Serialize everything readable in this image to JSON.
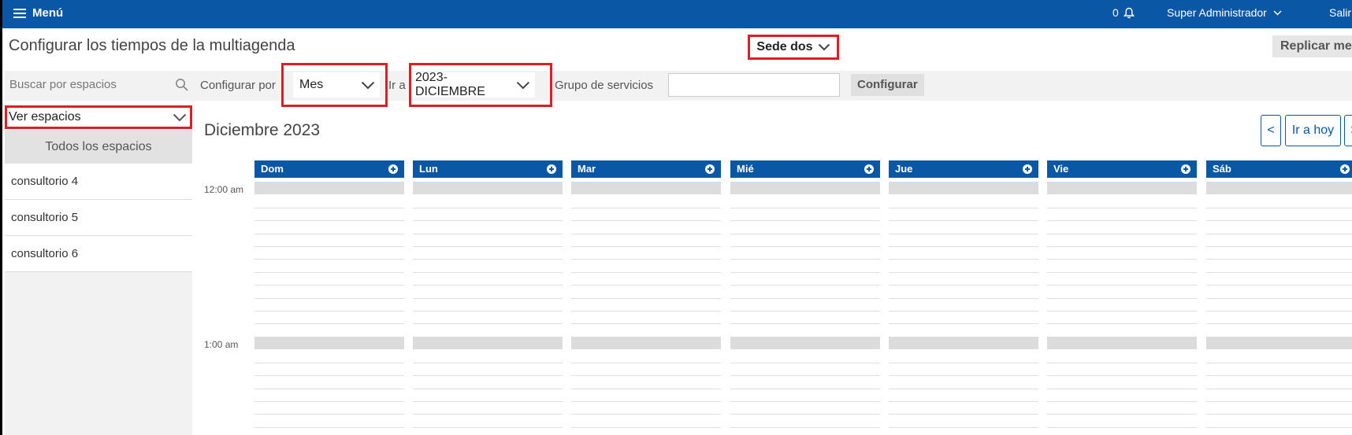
{
  "topbar": {
    "menu_label": "Menú",
    "notif_count": "0",
    "user_label": "Super Administrador",
    "logout_label": "Salir"
  },
  "page": {
    "title": "Configurar los tiempos de la multiagenda",
    "sede_label": "Sede dos",
    "replicar_label": "Replicar mes"
  },
  "sidebar": {
    "search_placeholder": "Buscar por espacios",
    "ver_espacios": "Ver espacios",
    "todos_label": "Todos los espacios",
    "items": [
      {
        "label": "consultorio 4"
      },
      {
        "label": "consultorio 5"
      },
      {
        "label": "consultorio 6"
      }
    ]
  },
  "filters": {
    "configurar_por_label": "Configurar por",
    "configurar_por_value": "Mes",
    "ir_a_label": "Ir a",
    "ir_a_value": "2023-DICIEMBRE",
    "grupo_label": "Grupo de servicios",
    "grupo_value": "",
    "configurar_button": "Configurar"
  },
  "calendar": {
    "month_title": "Diciembre 2023",
    "prev_label": "<",
    "today_label": "Ir a hoy",
    "next_label": ">",
    "days": [
      "Dom",
      "Lun",
      "Mar",
      "Mié",
      "Jue",
      "Vie",
      "Sáb"
    ],
    "hours": [
      "12:00 am",
      "1:00 am"
    ]
  },
  "colors": {
    "brand": "#0a57a6",
    "highlight": "#e11d24"
  }
}
